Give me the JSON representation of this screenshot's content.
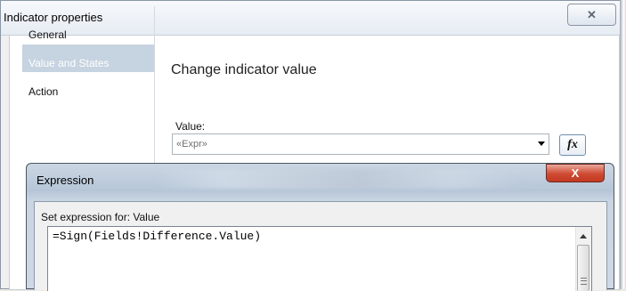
{
  "outer_dialog": {
    "title": "Indicator properties",
    "close_glyph": "✕",
    "nav": {
      "items": [
        {
          "label": "General",
          "selected": false
        },
        {
          "label": "Value and States",
          "selected": true
        },
        {
          "label": "Action",
          "selected": false
        }
      ]
    },
    "main": {
      "heading": "Change indicator value",
      "value_label": "Value:",
      "value_field": "«Expr»",
      "fx_label": "fx"
    }
  },
  "expression_dialog": {
    "title": "Expression",
    "close_glyph": "X",
    "set_label": "Set expression for: Value",
    "expression": "=Sign(Fields!Difference.Value)"
  },
  "colors": {
    "selected_nav": "#c6d3e0",
    "close_red": "#cf4a32"
  },
  "icons": [
    "close-icon",
    "dropdown-arrow-icon",
    "function-icon",
    "scroll-up-icon"
  ]
}
